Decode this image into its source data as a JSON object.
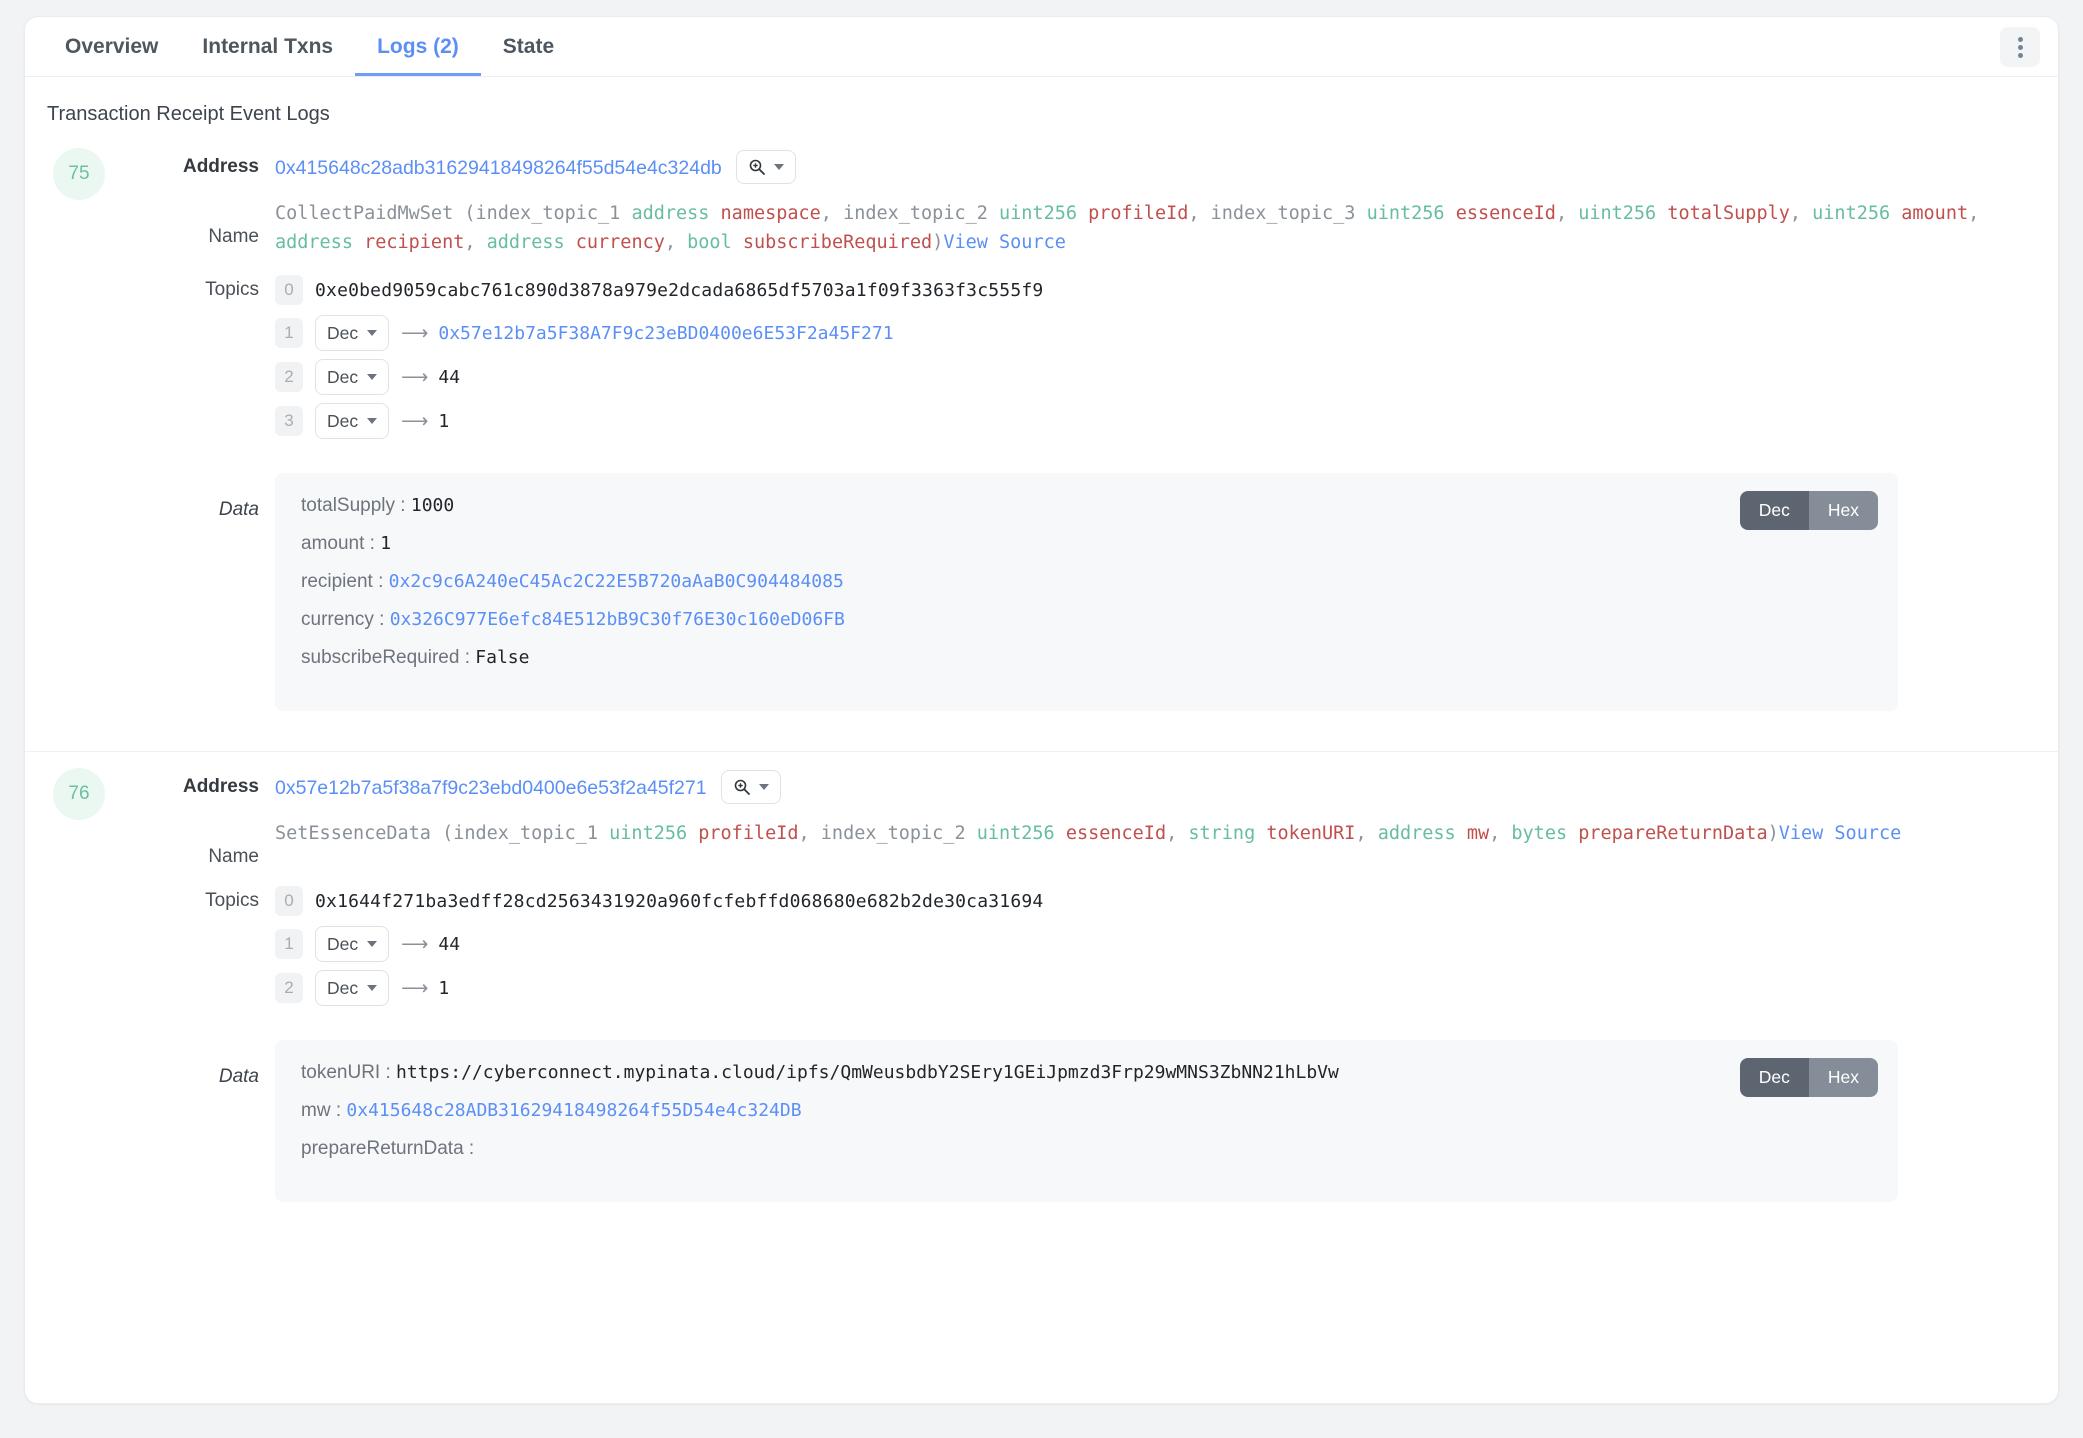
{
  "tabs": [
    {
      "label": "Overview",
      "active": false
    },
    {
      "label": "Internal Txns",
      "active": false
    },
    {
      "label": "Logs (2)",
      "active": true
    },
    {
      "label": "State",
      "active": false
    }
  ],
  "section_title": "Transaction Receipt Event Logs",
  "labels": {
    "address": "Address",
    "name": "Name",
    "topics": "Topics",
    "data": "Data",
    "view_source": "View Source",
    "dec": "Dec",
    "hex": "Hex",
    "arrow": "⟶",
    "colon": " : "
  },
  "colors": {
    "accent": "#5b8ff6",
    "badge_bg": "#ebf7f1",
    "badge_fg": "#6cc0a0",
    "type_green": "#67bda0",
    "param_red": "#c0504d",
    "toggle_on": "#5d6670",
    "toggle_off": "#848d98",
    "data_bg": "#f7f8fa"
  },
  "logs": [
    {
      "index": "75",
      "address": "0x415648c28adb31629418498264f55d54e4c324db",
      "signature": {
        "event": "CollectPaidMwSet",
        "open": " (",
        "parts": [
          {
            "text": "index_topic_1 ",
            "kind": "plain"
          },
          {
            "text": "address ",
            "kind": "type"
          },
          {
            "text": "namespace",
            "kind": "param"
          },
          {
            "text": ", index_topic_2 ",
            "kind": "plain"
          },
          {
            "text": "uint256 ",
            "kind": "type"
          },
          {
            "text": "profileId",
            "kind": "param"
          },
          {
            "text": ", index_topic_3 ",
            "kind": "plain"
          },
          {
            "text": "uint256 ",
            "kind": "type"
          },
          {
            "text": "essenceId",
            "kind": "param"
          },
          {
            "text": ", ",
            "kind": "plain"
          },
          {
            "text": "uint256 ",
            "kind": "type"
          },
          {
            "text": "totalSupply",
            "kind": "param"
          },
          {
            "text": ", ",
            "kind": "plain"
          },
          {
            "text": "uint256 ",
            "kind": "type"
          },
          {
            "text": "amount",
            "kind": "param"
          },
          {
            "text": ", ",
            "kind": "plain"
          },
          {
            "text": "address ",
            "kind": "type"
          },
          {
            "text": "recipient",
            "kind": "param"
          },
          {
            "text": ", ",
            "kind": "plain"
          },
          {
            "text": "address ",
            "kind": "type"
          },
          {
            "text": "currency",
            "kind": "param"
          },
          {
            "text": ", ",
            "kind": "plain"
          },
          {
            "text": "bool ",
            "kind": "type"
          },
          {
            "text": "subscribeRequired",
            "kind": "param"
          }
        ],
        "close": ")"
      },
      "topics": [
        {
          "idx": "0",
          "format": null,
          "value": "0xe0bed9059cabc761c890d3878a979e2dcada6865df5703a1f09f3363f3c555f9",
          "link": false
        },
        {
          "idx": "1",
          "format": "Dec",
          "value": "0x57e12b7a5F38A7F9c23eBD0400e6E53F2a45F271",
          "link": true
        },
        {
          "idx": "2",
          "format": "Dec",
          "value": "44",
          "link": false
        },
        {
          "idx": "3",
          "format": "Dec",
          "value": "1",
          "link": false
        }
      ],
      "data": {
        "mode": "Dec",
        "fields": [
          {
            "key": "totalSupply",
            "value": "1000",
            "link": false
          },
          {
            "key": "amount",
            "value": "1",
            "link": false
          },
          {
            "key": "recipient",
            "value": "0x2c9c6A240eC45Ac2C22E5B720aAaB0C904484085",
            "link": true
          },
          {
            "key": "currency",
            "value": "0x326C977E6efc84E512bB9C30f76E30c160eD06FB",
            "link": true
          },
          {
            "key": "subscribeRequired",
            "value": "False",
            "link": false
          }
        ]
      }
    },
    {
      "index": "76",
      "address": "0x57e12b7a5f38a7f9c23ebd0400e6e53f2a45f271",
      "signature": {
        "event": "SetEssenceData",
        "open": " (",
        "parts": [
          {
            "text": "index_topic_1 ",
            "kind": "plain"
          },
          {
            "text": "uint256 ",
            "kind": "type"
          },
          {
            "text": "profileId",
            "kind": "param"
          },
          {
            "text": ", index_topic_2 ",
            "kind": "plain"
          },
          {
            "text": "uint256 ",
            "kind": "type"
          },
          {
            "text": "essenceId",
            "kind": "param"
          },
          {
            "text": ", ",
            "kind": "plain"
          },
          {
            "text": "string ",
            "kind": "type"
          },
          {
            "text": "tokenURI",
            "kind": "param"
          },
          {
            "text": ", ",
            "kind": "plain"
          },
          {
            "text": "address ",
            "kind": "type"
          },
          {
            "text": "mw",
            "kind": "param"
          },
          {
            "text": ", ",
            "kind": "plain"
          },
          {
            "text": "bytes ",
            "kind": "type"
          },
          {
            "text": "prepareReturnData",
            "kind": "param"
          }
        ],
        "close": ")"
      },
      "topics": [
        {
          "idx": "0",
          "format": null,
          "value": "0x1644f271ba3edff28cd2563431920a960fcfebffd068680e682b2de30ca31694",
          "link": false
        },
        {
          "idx": "1",
          "format": "Dec",
          "value": "44",
          "link": false
        },
        {
          "idx": "2",
          "format": "Dec",
          "value": "1",
          "link": false
        }
      ],
      "data": {
        "mode": "Dec",
        "fields": [
          {
            "key": "tokenURI",
            "value": "https://cyberconnect.mypinata.cloud/ipfs/QmWeusbdbY2SEry1GEiJpmzd3Frp29wMNS3ZbNN21hLbVw",
            "link": false
          },
          {
            "key": "mw",
            "value": "0x415648c28ADB31629418498264f55D54e4c324DB",
            "link": true
          },
          {
            "key": "prepareReturnData",
            "value": "",
            "link": false
          }
        ]
      }
    }
  ]
}
